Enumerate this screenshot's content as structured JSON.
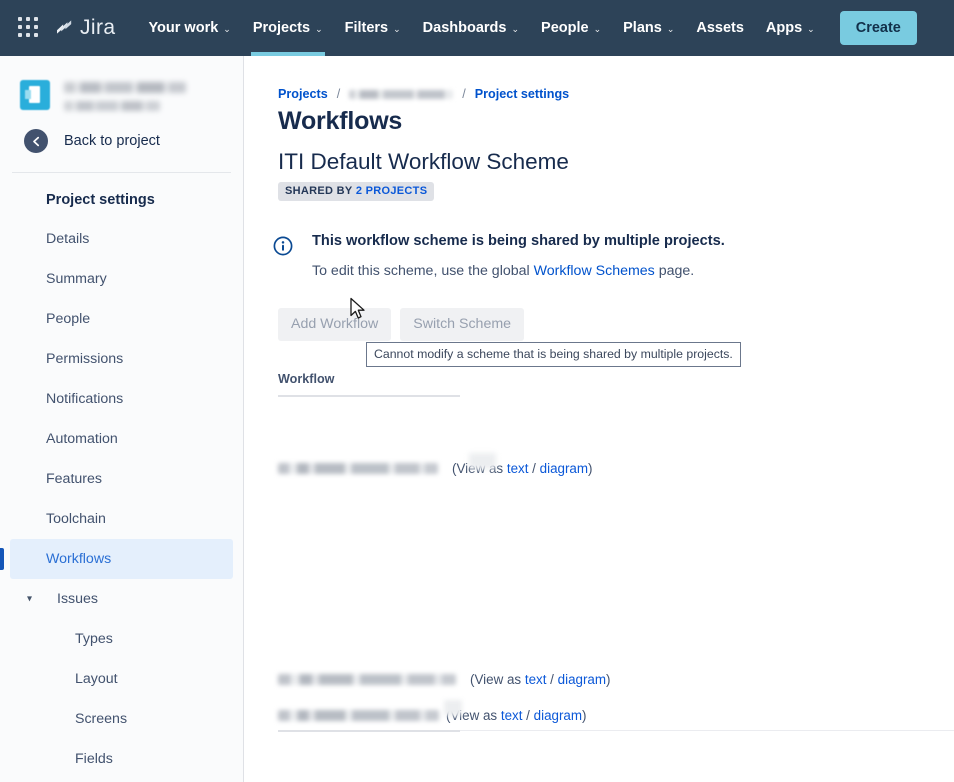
{
  "topnav": {
    "app_switcher_icon": "grid-apps-icon",
    "logo_text": "Jira",
    "logo_icon": "jira-logo-icon",
    "items": [
      {
        "label": "Your work",
        "has_caret": true,
        "active": false
      },
      {
        "label": "Projects",
        "has_caret": true,
        "active": true
      },
      {
        "label": "Filters",
        "has_caret": true,
        "active": false
      },
      {
        "label": "Dashboards",
        "has_caret": true,
        "active": false
      },
      {
        "label": "People",
        "has_caret": true,
        "active": false
      },
      {
        "label": "Plans",
        "has_caret": true,
        "active": false
      },
      {
        "label": "Assets",
        "has_caret": false,
        "active": false
      },
      {
        "label": "Apps",
        "has_caret": true,
        "active": false
      }
    ],
    "create_label": "Create",
    "caret_glyph": "⌄",
    "accent_color": "#79cbe0",
    "background_color": "#2d4358"
  },
  "sidebar": {
    "project_name_redacted": true,
    "project_subtitle_redacted": true,
    "back_label": "Back to project",
    "back_icon": "arrow-left-circle-icon",
    "items": [
      {
        "label": "Project settings",
        "type": "heading",
        "selected": false
      },
      {
        "label": "Details",
        "type": "item",
        "selected": false
      },
      {
        "label": "Summary",
        "type": "item",
        "selected": false
      },
      {
        "label": "People",
        "type": "item",
        "selected": false
      },
      {
        "label": "Permissions",
        "type": "item",
        "selected": false
      },
      {
        "label": "Notifications",
        "type": "item",
        "selected": false
      },
      {
        "label": "Automation",
        "type": "item",
        "selected": false
      },
      {
        "label": "Features",
        "type": "item",
        "selected": false
      },
      {
        "label": "Toolchain",
        "type": "item",
        "selected": false
      },
      {
        "label": "Workflows",
        "type": "item",
        "selected": true
      },
      {
        "label": "Issues",
        "type": "group",
        "selected": false,
        "expanded": true,
        "chevron_icon": "chevron-down-icon"
      },
      {
        "label": "Types",
        "type": "sub",
        "selected": false
      },
      {
        "label": "Layout",
        "type": "sub",
        "selected": false
      },
      {
        "label": "Screens",
        "type": "sub",
        "selected": false
      },
      {
        "label": "Fields",
        "type": "sub",
        "selected": false
      }
    ],
    "selected_bg": "#e4effc",
    "selected_text": "#2a6fd4",
    "selected_indicator": "#1456b8"
  },
  "main": {
    "breadcrumb": {
      "first": "Projects",
      "second_redacted": true,
      "third": "Project settings",
      "separator": "/"
    },
    "page_title": "Workflows",
    "scheme_title": "ITI Default Workflow Scheme",
    "badge": {
      "prefix": "SHARED BY",
      "link": "2 PROJECTS"
    },
    "info": {
      "icon": "info-circle-icon",
      "title": "This workflow scheme is being shared by multiple projects.",
      "text_before": "To edit this scheme, use the global",
      "link": "Workflow Schemes",
      "text_after": "page."
    },
    "buttons": {
      "add_workflow": "Add Workflow",
      "switch_scheme": "Switch Scheme",
      "both_disabled": true
    },
    "tooltip": "Cannot modify a scheme that is being shared by multiple projects.",
    "cursor_icon": "mouse-pointer-arrow",
    "table": {
      "column_header": "Workflow",
      "view_as_label": "(View as",
      "text_link": "text",
      "link_separator": "/",
      "diagram_link": "diagram",
      "closing_paren": ")",
      "rows": [
        {
          "name_redacted": true,
          "partially_masked_prefix": true,
          "visible_suffix": "ew as",
          "view_as_label": "(View as"
        },
        {
          "name_redacted": true,
          "partially_masked_prefix": false,
          "visible_suffix": "",
          "view_as_label": "(View as"
        },
        {
          "name_redacted": true,
          "partially_masked_prefix": true,
          "visible_suffix": "iew as",
          "view_as_label": "(View as"
        }
      ]
    },
    "link_color": "#0052cc"
  }
}
